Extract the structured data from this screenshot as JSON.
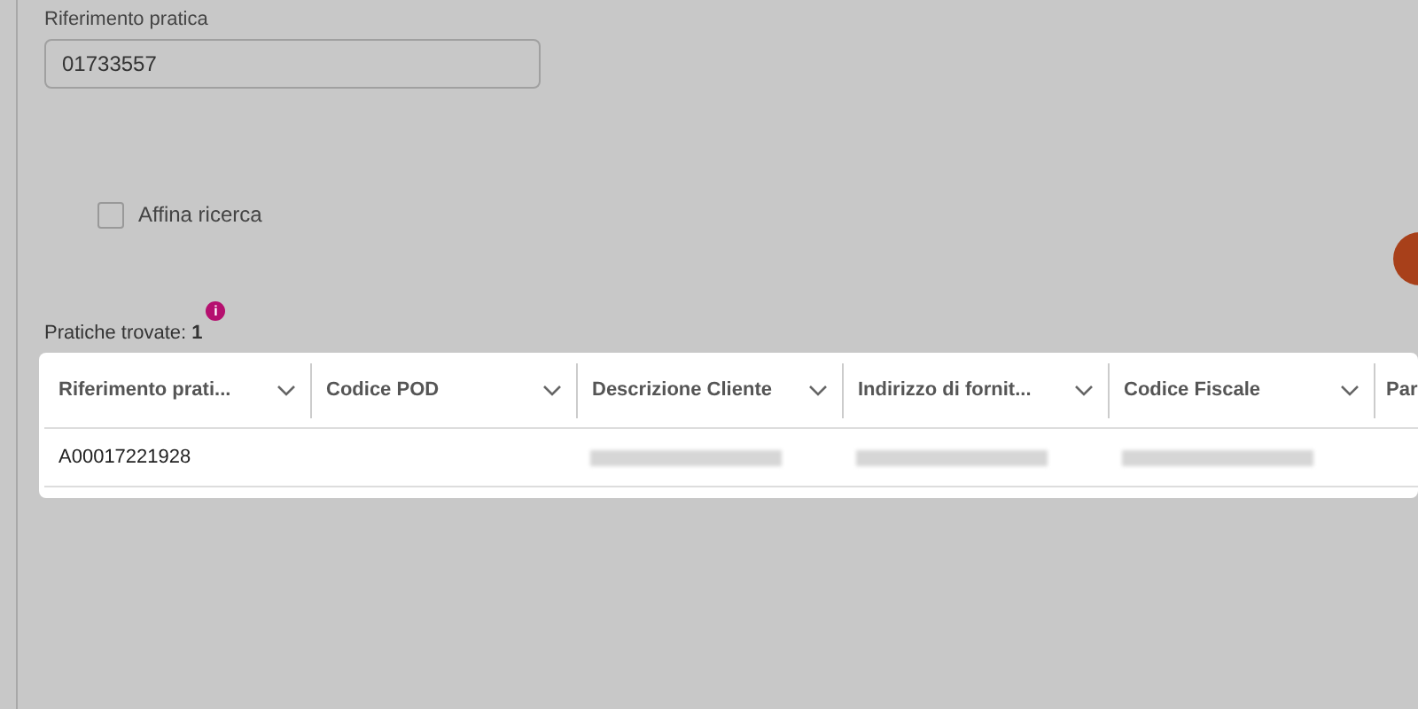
{
  "search_form": {
    "reference_field": {
      "label": "Riferimento pratica",
      "value": "01733557"
    },
    "refine_search": {
      "label": "Affina ricerca",
      "checked": false
    }
  },
  "results": {
    "label": "Pratiche trovate:",
    "count": "1",
    "info_badge": "i"
  },
  "table": {
    "columns": [
      {
        "label": "Riferimento prati...",
        "sortable": true
      },
      {
        "label": "Codice POD",
        "sortable": true
      },
      {
        "label": "Descrizione Cliente",
        "sortable": true
      },
      {
        "label": "Indirizzo di fornit...",
        "sortable": true
      },
      {
        "label": "Codice Fiscale",
        "sortable": true
      },
      {
        "label": "Par"
      }
    ],
    "rows": [
      {
        "cells": [
          {
            "kind": "text",
            "text": "A00017221928"
          },
          {
            "kind": "empty"
          },
          {
            "kind": "redacted"
          },
          {
            "kind": "redacted"
          },
          {
            "kind": "redacted"
          },
          {
            "kind": "empty"
          }
        ]
      }
    ]
  }
}
